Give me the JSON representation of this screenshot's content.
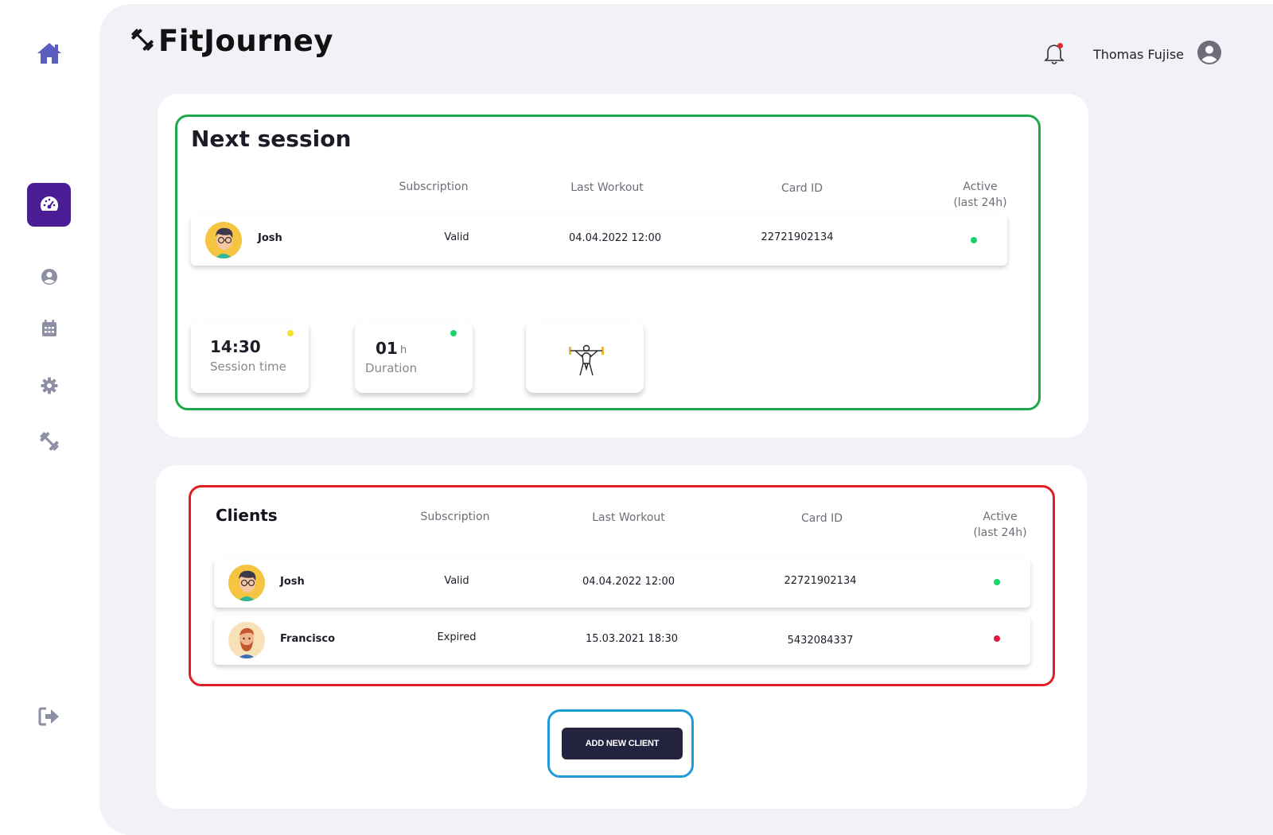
{
  "app": {
    "name": "FitJourney"
  },
  "sidebar": {
    "items": [
      {
        "icon": "home-icon"
      },
      {
        "icon": "dashboard-icon",
        "active": true
      },
      {
        "icon": "user-icon"
      },
      {
        "icon": "calendar-icon"
      },
      {
        "icon": "settings-icon"
      },
      {
        "icon": "dumbbell-icon"
      },
      {
        "icon": "logout-icon"
      }
    ]
  },
  "header": {
    "user_name": "Thomas Fujise",
    "notifications": {
      "has_unread": true
    }
  },
  "next_session": {
    "title": "Next session",
    "columns": {
      "subscription": "Subscription",
      "last_workout": "Last Workout",
      "card_id": "Card ID",
      "active_line1": "Active",
      "active_line2": "(last 24h)"
    },
    "client": {
      "name": "Josh",
      "subscription": "Valid",
      "last_workout": "04.04.2022 12:00",
      "card_id": "22721902134",
      "active": true
    },
    "tiles": {
      "session_time": {
        "value": "14:30",
        "label": "Session time",
        "status_color": "#f5e12a"
      },
      "duration": {
        "value": "01",
        "unit": "h",
        "label": "Duration",
        "status_color": "#19d46c"
      }
    }
  },
  "clients": {
    "title": "Clients",
    "columns": {
      "subscription": "Subscription",
      "last_workout": "Last Workout",
      "card_id": "Card ID",
      "active_line1": "Active",
      "active_line2": "(last 24h)"
    },
    "rows": [
      {
        "name": "Josh",
        "subscription": "Valid",
        "last_workout": "04.04.2022 12:00",
        "card_id": "22721902134",
        "active": true
      },
      {
        "name": "Francisco",
        "subscription": "Expired",
        "last_workout": "15.03.2021 18:30",
        "card_id": "5432084337",
        "active": false
      }
    ],
    "add_button": "ADD NEW CLIENT"
  },
  "colors": {
    "accent": "#4b1d95",
    "active": "#19d46c",
    "inactive": "#e0173a",
    "button": "#23233f"
  }
}
